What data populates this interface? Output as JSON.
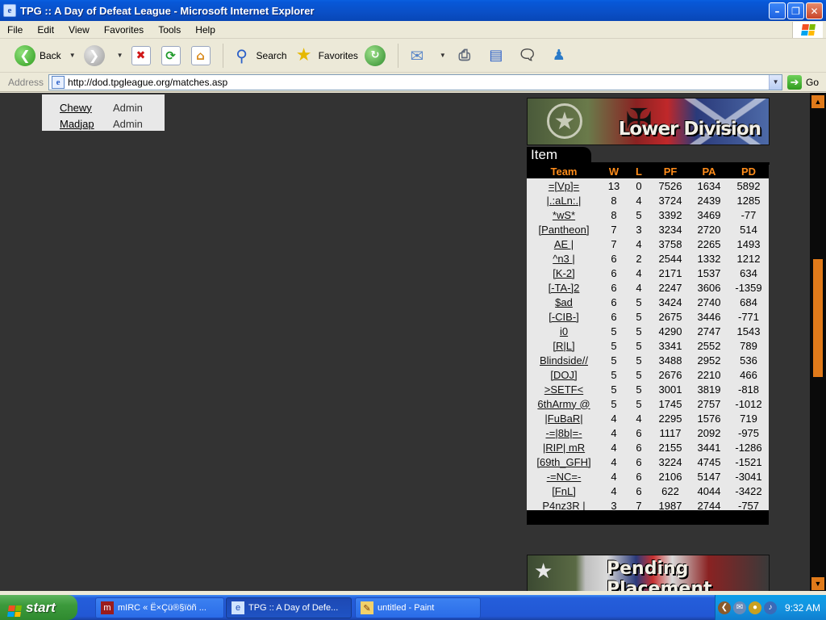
{
  "window": {
    "title": "TPG :: A Day of Defeat League - Microsoft Internet Explorer",
    "minimize_glyph": "–",
    "maximize_glyph": "❐",
    "close_glyph": "✕"
  },
  "menu": {
    "items": [
      "File",
      "Edit",
      "View",
      "Favorites",
      "Tools",
      "Help"
    ]
  },
  "toolbar": {
    "back_label": "Back",
    "search_label": "Search",
    "favorites_label": "Favorites"
  },
  "address": {
    "label": "Address",
    "url": "http://dod.tpgleague.org/matches.asp",
    "go_label": "Go"
  },
  "admins": [
    {
      "name": "Chewy",
      "role": "Admin"
    },
    {
      "name": "Madjap",
      "role": "Admin"
    }
  ],
  "division": {
    "banner_title": "Lower Division",
    "tab_label": "Item",
    "columns": [
      "Team",
      "W",
      "L",
      "PF",
      "PA",
      "PD"
    ],
    "rows": [
      {
        "team": "=[Vp]=",
        "w": "13",
        "l": "0",
        "pf": "7526",
        "pa": "1634",
        "pd": "5892"
      },
      {
        "team": "|.:aLn:.|",
        "w": "8",
        "l": "4",
        "pf": "3724",
        "pa": "2439",
        "pd": "1285"
      },
      {
        "team": "*wS*",
        "w": "8",
        "l": "5",
        "pf": "3392",
        "pa": "3469",
        "pd": "-77"
      },
      {
        "team": "[Pantheon]",
        "w": "7",
        "l": "3",
        "pf": "3234",
        "pa": "2720",
        "pd": "514"
      },
      {
        "team": "AE |",
        "w": "7",
        "l": "4",
        "pf": "3758",
        "pa": "2265",
        "pd": "1493"
      },
      {
        "team": "^n3 |",
        "w": "6",
        "l": "2",
        "pf": "2544",
        "pa": "1332",
        "pd": "1212"
      },
      {
        "team": "[K-2]",
        "w": "6",
        "l": "4",
        "pf": "2171",
        "pa": "1537",
        "pd": "634"
      },
      {
        "team": "[-TA-]2",
        "w": "6",
        "l": "4",
        "pf": "2247",
        "pa": "3606",
        "pd": "-1359"
      },
      {
        "team": "$ad",
        "w": "6",
        "l": "5",
        "pf": "3424",
        "pa": "2740",
        "pd": "684"
      },
      {
        "team": "[-CIB-]",
        "w": "6",
        "l": "5",
        "pf": "2675",
        "pa": "3446",
        "pd": "-771"
      },
      {
        "team": "i0",
        "w": "5",
        "l": "5",
        "pf": "4290",
        "pa": "2747",
        "pd": "1543"
      },
      {
        "team": "[R|L]",
        "w": "5",
        "l": "5",
        "pf": "3341",
        "pa": "2552",
        "pd": "789"
      },
      {
        "team": "Blindside//",
        "w": "5",
        "l": "5",
        "pf": "3488",
        "pa": "2952",
        "pd": "536"
      },
      {
        "team": "[DOJ]",
        "w": "5",
        "l": "5",
        "pf": "2676",
        "pa": "2210",
        "pd": "466"
      },
      {
        "team": ">SETF<",
        "w": "5",
        "l": "5",
        "pf": "3001",
        "pa": "3819",
        "pd": "-818"
      },
      {
        "team": "6thArmy @",
        "w": "5",
        "l": "5",
        "pf": "1745",
        "pa": "2757",
        "pd": "-1012"
      },
      {
        "team": "|FuBaR|",
        "w": "4",
        "l": "4",
        "pf": "2295",
        "pa": "1576",
        "pd": "719"
      },
      {
        "team": "-=|8b|=-",
        "w": "4",
        "l": "6",
        "pf": "1117",
        "pa": "2092",
        "pd": "-975"
      },
      {
        "team": "|RIP| mR",
        "w": "4",
        "l": "6",
        "pf": "2155",
        "pa": "3441",
        "pd": "-1286"
      },
      {
        "team": "[69th_GFH]",
        "w": "4",
        "l": "6",
        "pf": "3224",
        "pa": "4745",
        "pd": "-1521"
      },
      {
        "team": "-=NC=-",
        "w": "4",
        "l": "6",
        "pf": "2106",
        "pa": "5147",
        "pd": "-3041"
      },
      {
        "team": "[FnL]",
        "w": "4",
        "l": "6",
        "pf": "622",
        "pa": "4044",
        "pd": "-3422"
      },
      {
        "team": "P4nz3R |",
        "w": "3",
        "l": "7",
        "pf": "1987",
        "pa": "2744",
        "pd": "-757"
      }
    ]
  },
  "pending": {
    "banner_title": "Pending Placement"
  },
  "taskbar": {
    "start_label": "start",
    "tasks": [
      {
        "label": "mIRC  « Ë×Çü®§ïöñ ...",
        "active": false
      },
      {
        "label": "TPG :: A Day of Defe...",
        "active": true
      },
      {
        "label": "untitled - Paint",
        "active": false
      }
    ],
    "clock": "9:32 AM"
  },
  "colors": {
    "content_bg": "#333333",
    "header_accent": "#ff8c1a",
    "scrollbar_accent": "#e07a1a",
    "row_bg": "#e8e8e8"
  }
}
